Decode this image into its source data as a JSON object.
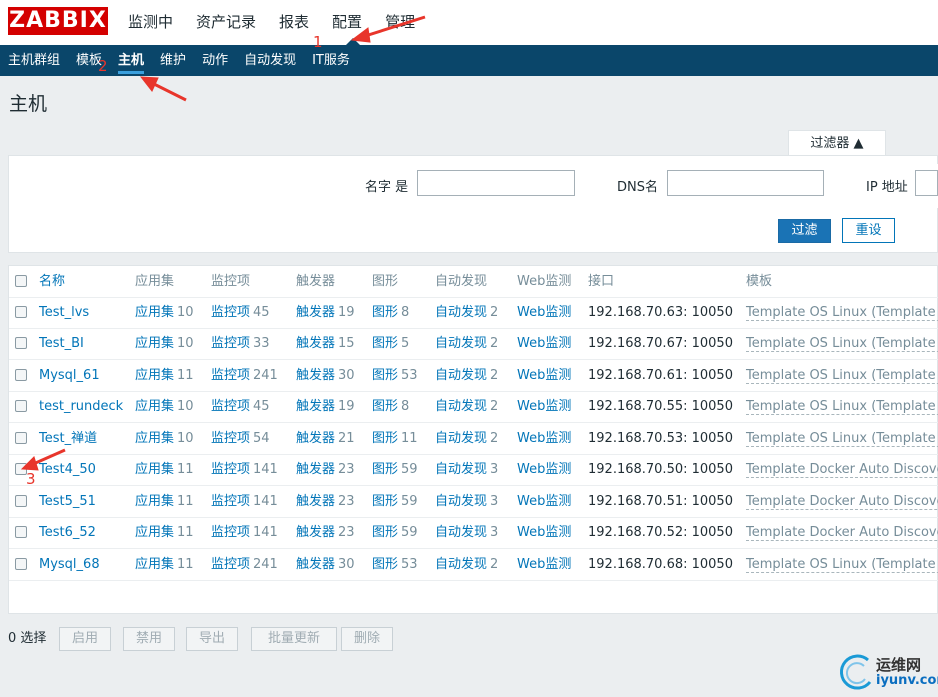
{
  "logo": "ZABBIX",
  "main_nav": [
    {
      "label": "监测中"
    },
    {
      "label": "资产记录"
    },
    {
      "label": "报表"
    },
    {
      "label": "配置"
    },
    {
      "label": "管理"
    }
  ],
  "sub_nav": [
    {
      "label": "主机群组"
    },
    {
      "label": "模板"
    },
    {
      "label": "主机"
    },
    {
      "label": "维护"
    },
    {
      "label": "动作"
    },
    {
      "label": "自动发现"
    },
    {
      "label": "IT服务"
    }
  ],
  "page_title": "主机",
  "filter": {
    "tab_label": "过滤器 ▲",
    "name_label": "名字 是",
    "name_value": "",
    "dns_label": "DNS名",
    "dns_value": "",
    "ip_label": "IP 地址",
    "ip_value": "",
    "apply_label": "过滤",
    "reset_label": "重设"
  },
  "table": {
    "headers": {
      "name": "名称",
      "apps": "应用集",
      "items": "监控项",
      "triggers": "触发器",
      "graphs": "图形",
      "discovery": "自动发现",
      "web": "Web监测",
      "interface": "接口",
      "templates": "模板"
    },
    "rows": [
      {
        "name": "Test_lvs",
        "apps": "应用集",
        "apps_n": "10",
        "items": "监控项",
        "items_n": "45",
        "triggers": "触发器",
        "triggers_n": "19",
        "graphs": "图形",
        "graphs_n": "8",
        "discovery": "自动发现",
        "discovery_n": "2",
        "web": "Web监测",
        "interface": "192.168.70.63: 10050",
        "templates": "Template OS Linux (Template App"
      },
      {
        "name": "Test_BI",
        "apps": "应用集",
        "apps_n": "10",
        "items": "监控项",
        "items_n": "33",
        "triggers": "触发器",
        "triggers_n": "15",
        "graphs": "图形",
        "graphs_n": "5",
        "discovery": "自动发现",
        "discovery_n": "2",
        "web": "Web监测",
        "interface": "192.168.70.67: 10050",
        "templates": "Template OS Linux (Template App"
      },
      {
        "name": "Mysql_61",
        "apps": "应用集",
        "apps_n": "11",
        "items": "监控项",
        "items_n": "241",
        "triggers": "触发器",
        "triggers_n": "30",
        "graphs": "图形",
        "graphs_n": "53",
        "discovery": "自动发现",
        "discovery_n": "2",
        "web": "Web监测",
        "interface": "192.168.70.61: 10050",
        "templates": "Template OS Linux (Template App"
      },
      {
        "name": "test_rundeck",
        "apps": "应用集",
        "apps_n": "10",
        "items": "监控项",
        "items_n": "45",
        "triggers": "触发器",
        "triggers_n": "19",
        "graphs": "图形",
        "graphs_n": "8",
        "discovery": "自动发现",
        "discovery_n": "2",
        "web": "Web监测",
        "interface": "192.168.70.55: 10050",
        "templates": "Template OS Linux (Template App"
      },
      {
        "name": "Test_禅道",
        "apps": "应用集",
        "apps_n": "10",
        "items": "监控项",
        "items_n": "54",
        "triggers": "触发器",
        "triggers_n": "21",
        "graphs": "图形",
        "graphs_n": "11",
        "discovery": "自动发现",
        "discovery_n": "2",
        "web": "Web监测",
        "interface": "192.168.70.53: 10050",
        "templates": "Template OS Linux (Template App"
      },
      {
        "name": "Test4_50",
        "apps": "应用集",
        "apps_n": "11",
        "items": "监控项",
        "items_n": "141",
        "triggers": "触发器",
        "triggers_n": "23",
        "graphs": "图形",
        "graphs_n": "59",
        "discovery": "自动发现",
        "discovery_n": "3",
        "web": "Web监测",
        "interface": "192.168.70.50: 10050",
        "templates": "Template Docker Auto Discovery,"
      },
      {
        "name": "Test5_51",
        "apps": "应用集",
        "apps_n": "11",
        "items": "监控项",
        "items_n": "141",
        "triggers": "触发器",
        "triggers_n": "23",
        "graphs": "图形",
        "graphs_n": "59",
        "discovery": "自动发现",
        "discovery_n": "3",
        "web": "Web监测",
        "interface": "192.168.70.51: 10050",
        "templates": "Template Docker Auto Discovery,"
      },
      {
        "name": "Test6_52",
        "apps": "应用集",
        "apps_n": "11",
        "items": "监控项",
        "items_n": "141",
        "triggers": "触发器",
        "triggers_n": "23",
        "graphs": "图形",
        "graphs_n": "59",
        "discovery": "自动发现",
        "discovery_n": "3",
        "web": "Web监测",
        "interface": "192.168.70.52: 10050",
        "templates": "Template Docker Auto Discovery,"
      },
      {
        "name": "Mysql_68",
        "apps": "应用集",
        "apps_n": "11",
        "items": "监控项",
        "items_n": "241",
        "triggers": "触发器",
        "triggers_n": "30",
        "graphs": "图形",
        "graphs_n": "53",
        "discovery": "自动发现",
        "discovery_n": "2",
        "web": "Web监测",
        "interface": "192.168.70.68: 10050",
        "templates": "Template OS Linux (Template App"
      }
    ]
  },
  "footer": {
    "selected": "0 选择",
    "enable": "启用",
    "disable": "禁用",
    "export": "导出",
    "mass_update": "批量更新",
    "delete": "删除"
  },
  "annotations": {
    "a1": "1",
    "a2": "2",
    "a3": "3"
  },
  "watermark": {
    "line1": "运维网",
    "line2": "iyunv.com"
  },
  "colors": {
    "nav_bg": "#0a466a",
    "link": "#0275b8",
    "logo": "#d40000",
    "annotation": "#e8352b"
  }
}
